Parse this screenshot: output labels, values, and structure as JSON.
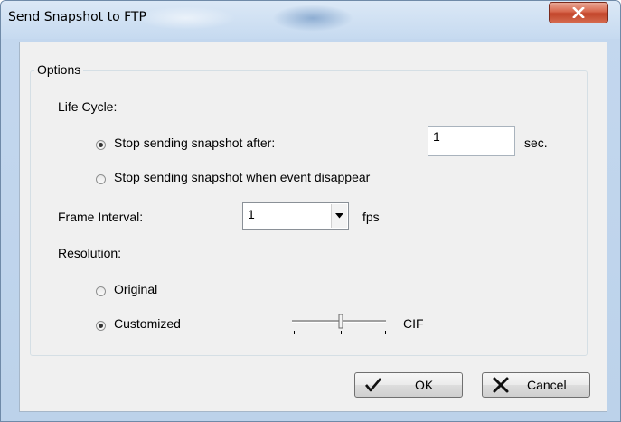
{
  "window": {
    "title": "Send Snapshot to FTP",
    "close_icon": "close-icon"
  },
  "options": {
    "legend": "Options",
    "life_cycle": {
      "label": "Life Cycle:",
      "stop_after_label": "Stop sending snapshot after:",
      "stop_after_selected": true,
      "seconds_value": "1",
      "seconds_unit": "sec.",
      "stop_on_disappear_label": "Stop sending snapshot when event disappear",
      "stop_on_disappear_selected": false
    },
    "frame_interval": {
      "label": "Frame Interval:",
      "value": "1",
      "unit": "fps"
    },
    "resolution": {
      "label": "Resolution:",
      "original_label": "Original",
      "original_selected": false,
      "customized_label": "Customized",
      "customized_selected": true,
      "slider_value_label": "CIF"
    }
  },
  "buttons": {
    "ok_label": "OK",
    "cancel_label": "Cancel"
  }
}
